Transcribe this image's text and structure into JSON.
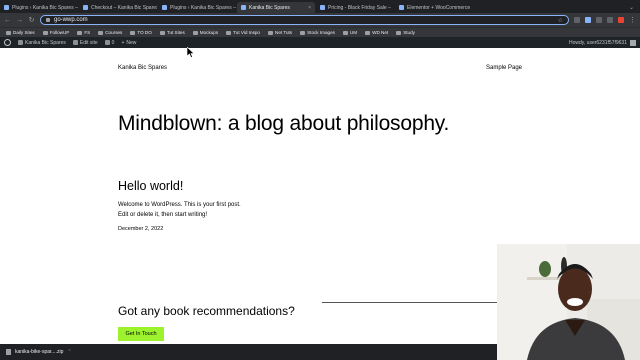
{
  "browser": {
    "tabs": [
      {
        "label": "Plugins ‹ Kanika Bic Spares —",
        "active": false
      },
      {
        "label": "Checkout – Kanika Bic Spares",
        "active": false
      },
      {
        "label": "Plugins ‹ Kanika Bic Spares —",
        "active": false
      },
      {
        "label": "Kanika Bic Spares",
        "active": true
      },
      {
        "label": "Pricing - Black Friday Sale –",
        "active": false
      },
      {
        "label": "Elementor + WooCommerce",
        "active": false
      }
    ],
    "url": "go-wwp.com",
    "bookmarks": [
      "Daily Sites",
      "FollowUP",
      "FS",
      "Courses",
      "TO DO",
      "Tut Sites",
      "Mockups",
      "Tut Vid Inspo",
      "Net Tuts",
      "Stock Images",
      "UM",
      "WD Net",
      "Study"
    ]
  },
  "wp_admin_bar": {
    "site_name": "Kanika Bic Spares",
    "edit_site": "Edit site",
    "comments_count": "0",
    "new_label": "New",
    "greeting": "Howdy, user6231f57f9631"
  },
  "site": {
    "title": "Kanika Bic Spares",
    "nav_item": "Sample Page",
    "hero_heading": "Mindblown: a blog about philosophy.",
    "post_title": "Hello world!",
    "post_body_line1": "Welcome to WordPress. This is your first post.",
    "post_body_line2": "Edit or delete it, then start writing!",
    "post_date": "December 2, 2022",
    "cta_heading": "Got any book recommendations?",
    "cta_button": "Get In Touch",
    "colors": {
      "cta_button": "#9cf22c"
    }
  },
  "download_bar": {
    "filename": "kanika-bike-spar....zip"
  }
}
